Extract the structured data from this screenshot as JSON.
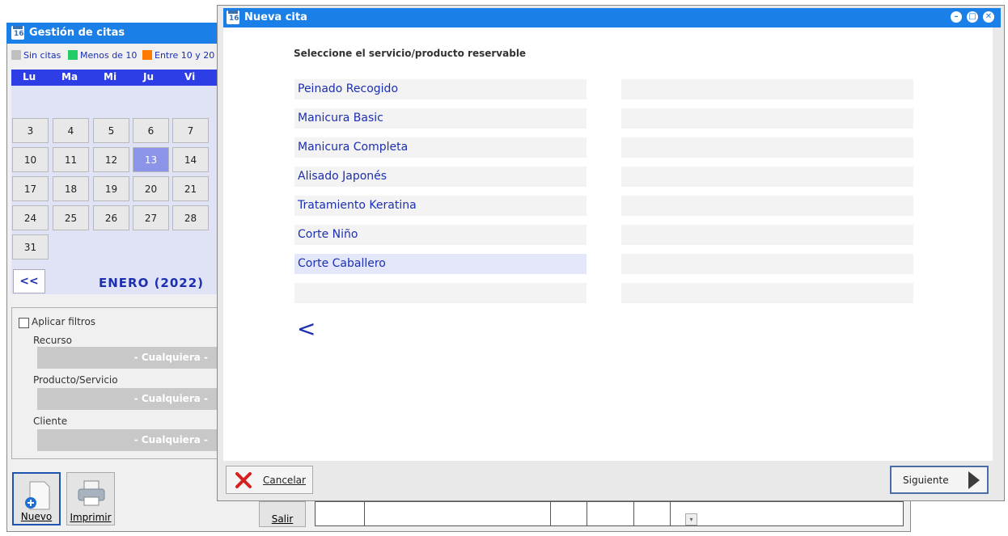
{
  "bg_window": {
    "title": "Gestión de citas",
    "legend": [
      {
        "label": "Sin citas",
        "color": "#c0c0c0"
      },
      {
        "label": "Menos de 10",
        "color": "#22cc66"
      },
      {
        "label": "Entre 10 y 20",
        "color": "#ff7a00"
      }
    ],
    "weekdays": [
      "Lu",
      "Ma",
      "Mi",
      "Ju",
      "Vi"
    ],
    "days": [
      "3",
      "4",
      "5",
      "6",
      "7",
      "10",
      "11",
      "12",
      "13",
      "14",
      "17",
      "18",
      "19",
      "20",
      "21",
      "24",
      "25",
      "26",
      "27",
      "28",
      "31"
    ],
    "selected_day": "13",
    "prev_label": "<<",
    "month_label": "ENERO  (2022)",
    "filters": {
      "apply_label": "Aplicar filtros",
      "resource_label": "Recurso",
      "resource_value": "- Cualquiera -",
      "product_label": "Producto/Servicio",
      "product_value": "- Cualquiera -",
      "client_label": "Cliente",
      "client_value": "- Cualquiera -"
    },
    "buttons": {
      "new": "Nuevo",
      "print": "Imprimir",
      "exit": "Salir"
    }
  },
  "modal": {
    "title": "Nueva cita",
    "prompt": "Seleccione el servicio/producto reservable",
    "items": [
      "Peinado Recogido",
      "Manicura Basic",
      "Manicura Completa",
      "Alisado Japonés",
      "Tratamiento Keratina",
      "Corte Niño",
      "Corte Caballero"
    ],
    "back_label": "<",
    "cancel_label": "Cancelar",
    "next_label": "Siguiente"
  },
  "colors": {
    "title_bar": "#1a7fe6",
    "link_blue": "#1c2fb0",
    "selected_day": "#8c94ea"
  }
}
